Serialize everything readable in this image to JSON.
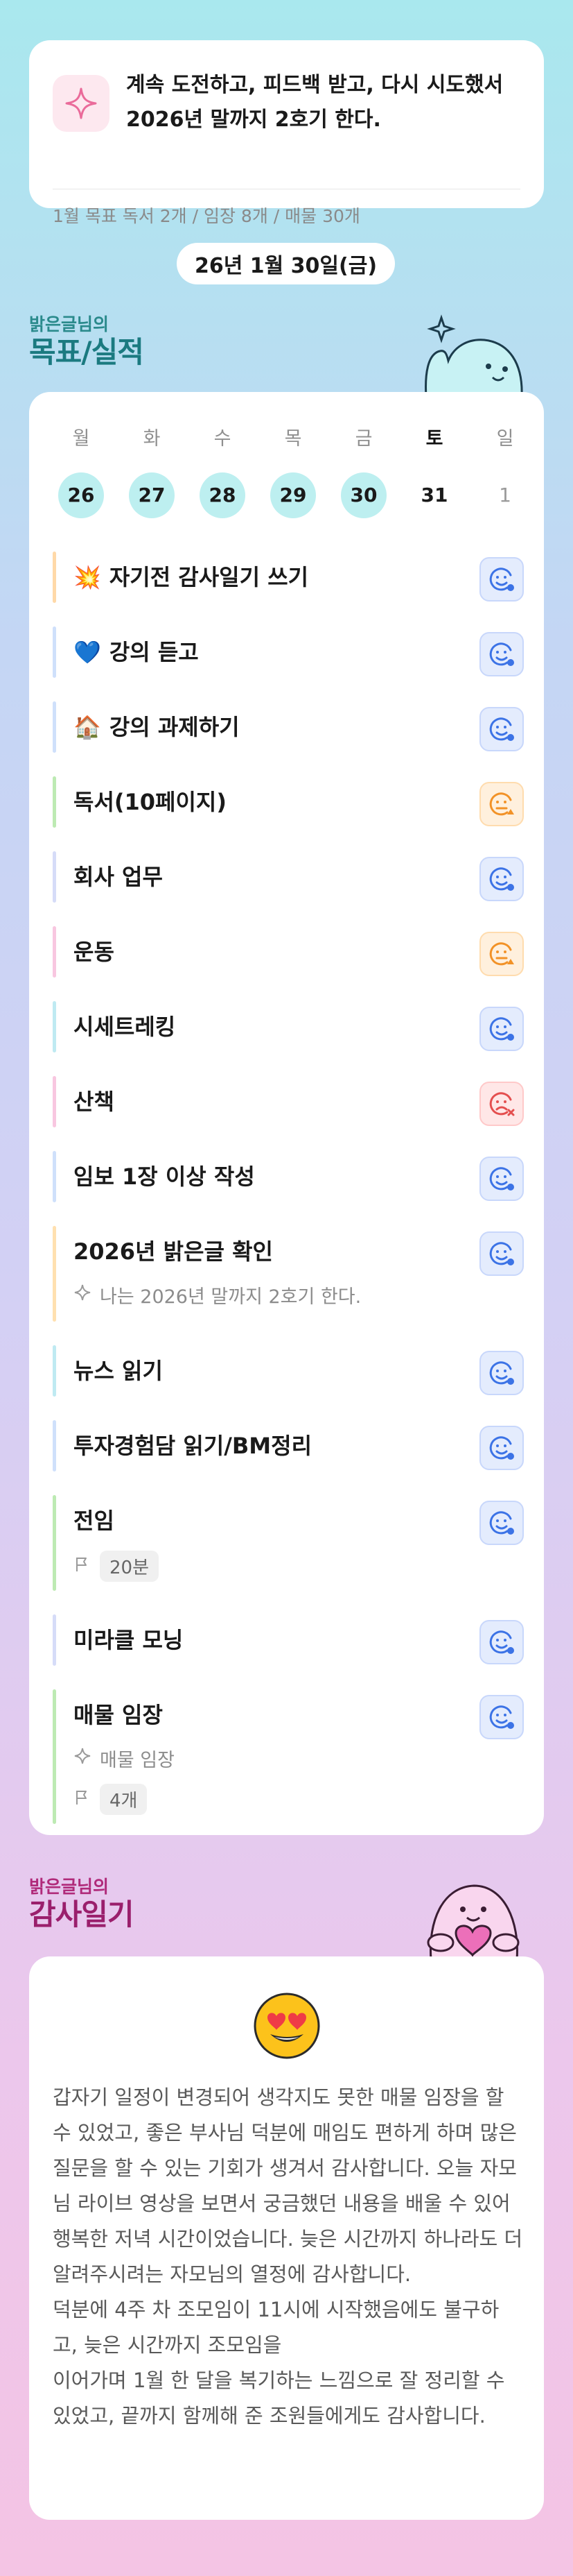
{
  "motto": {
    "icon": "sparkle-icon",
    "text": "계속 도전하고, 피드백 받고, 다시 시도했서 2026년 말까지 2호기 한다.",
    "monthly_goal": "1월 목표  독서 2개 / 임장 8개 / 매물 30개"
  },
  "date_label": "26년 1월 30일(금)",
  "goals_section": {
    "subtitle": "밝은글님의",
    "title": "목표/실적"
  },
  "week": [
    {
      "name": "월",
      "date": "26",
      "state": "filled"
    },
    {
      "name": "화",
      "date": "27",
      "state": "filled"
    },
    {
      "name": "수",
      "date": "28",
      "state": "filled"
    },
    {
      "name": "목",
      "date": "29",
      "state": "filled"
    },
    {
      "name": "금",
      "date": "30",
      "state": "filled"
    },
    {
      "name": "토",
      "date": "31",
      "state": "today"
    },
    {
      "name": "일",
      "date": "1",
      "state": "future"
    }
  ],
  "tasks": [
    {
      "label": "자기전 감사일기 쓰기",
      "emoji": "💥",
      "bar": "#ffd9a8",
      "status": "blue"
    },
    {
      "label": "강의 듣고",
      "emoji": "💙",
      "bar": "#cfe0fb",
      "status": "blue"
    },
    {
      "label": "강의 과제하기",
      "emoji": "🏠",
      "bar": "#cfe0fb",
      "status": "blue"
    },
    {
      "label": "독서(10페이지)",
      "emoji": "",
      "bar": "#bdeab3",
      "status": "orange"
    },
    {
      "label": "회사 업무",
      "emoji": "",
      "bar": "#d6dcf8",
      "status": "blue"
    },
    {
      "label": "운동",
      "emoji": "",
      "bar": "#f8c7e0",
      "status": "orange"
    },
    {
      "label": "시세트레킹",
      "emoji": "",
      "bar": "#bfeaf2",
      "status": "blue"
    },
    {
      "label": "산책",
      "emoji": "",
      "bar": "#f8c7e0",
      "status": "red"
    },
    {
      "label": "임보 1장 이상 작성",
      "emoji": "",
      "bar": "#cfe0fb",
      "status": "blue"
    },
    {
      "label": "2026년 밝은글 확인",
      "emoji": "",
      "bar": "#ffe0b0",
      "status": "blue",
      "note": "나는 2026년 말까지 2호기 한다."
    },
    {
      "label": "뉴스 읽기",
      "emoji": "",
      "bar": "#bfeaf2",
      "status": "blue"
    },
    {
      "label": "투자경험담 읽기/BM정리",
      "emoji": "",
      "bar": "#cfe0fb",
      "status": "blue"
    },
    {
      "label": "전임",
      "emoji": "",
      "bar": "#bdeab3",
      "status": "blue",
      "chip": "20분"
    },
    {
      "label": "미라클 모닝",
      "emoji": "",
      "bar": "#d6dcf8",
      "status": "blue"
    },
    {
      "label": "매물 임장",
      "emoji": "",
      "bar": "#bdeab3",
      "status": "blue",
      "note": "매물 임장",
      "chip": "4개"
    }
  ],
  "diary_section": {
    "subtitle": "밝은글님의",
    "title": "감사일기"
  },
  "diary": {
    "emoji": "heart-eyes-face-icon",
    "text": "갑자기 일정이 변경되어 생각지도 못한 매물 임장을 할 수 있었고, 좋은 부사님 덕분에 매임도 편하게 하며 많은 질문을 할 수 있는 기회가 생겨서 감사합니다. 오늘 자모님 라이브 영상을 보면서 궁금했던 내용을 배울 수 있어 행복한 저녁 시간이었습니다. 늦은 시간까지 하나라도 더 알려주시려는 자모님의 열정에 감사합니다.\n덕분에 4주 차 조모임이 11시에 시작했음에도 불구하고, 늦은 시간까지 조모임을\n이어가며 1월 한 달을 복기하는 느낌으로 잘 정리할 수 있었고, 끝까지 함께해 준 조원들에게도 감사합니다."
  }
}
